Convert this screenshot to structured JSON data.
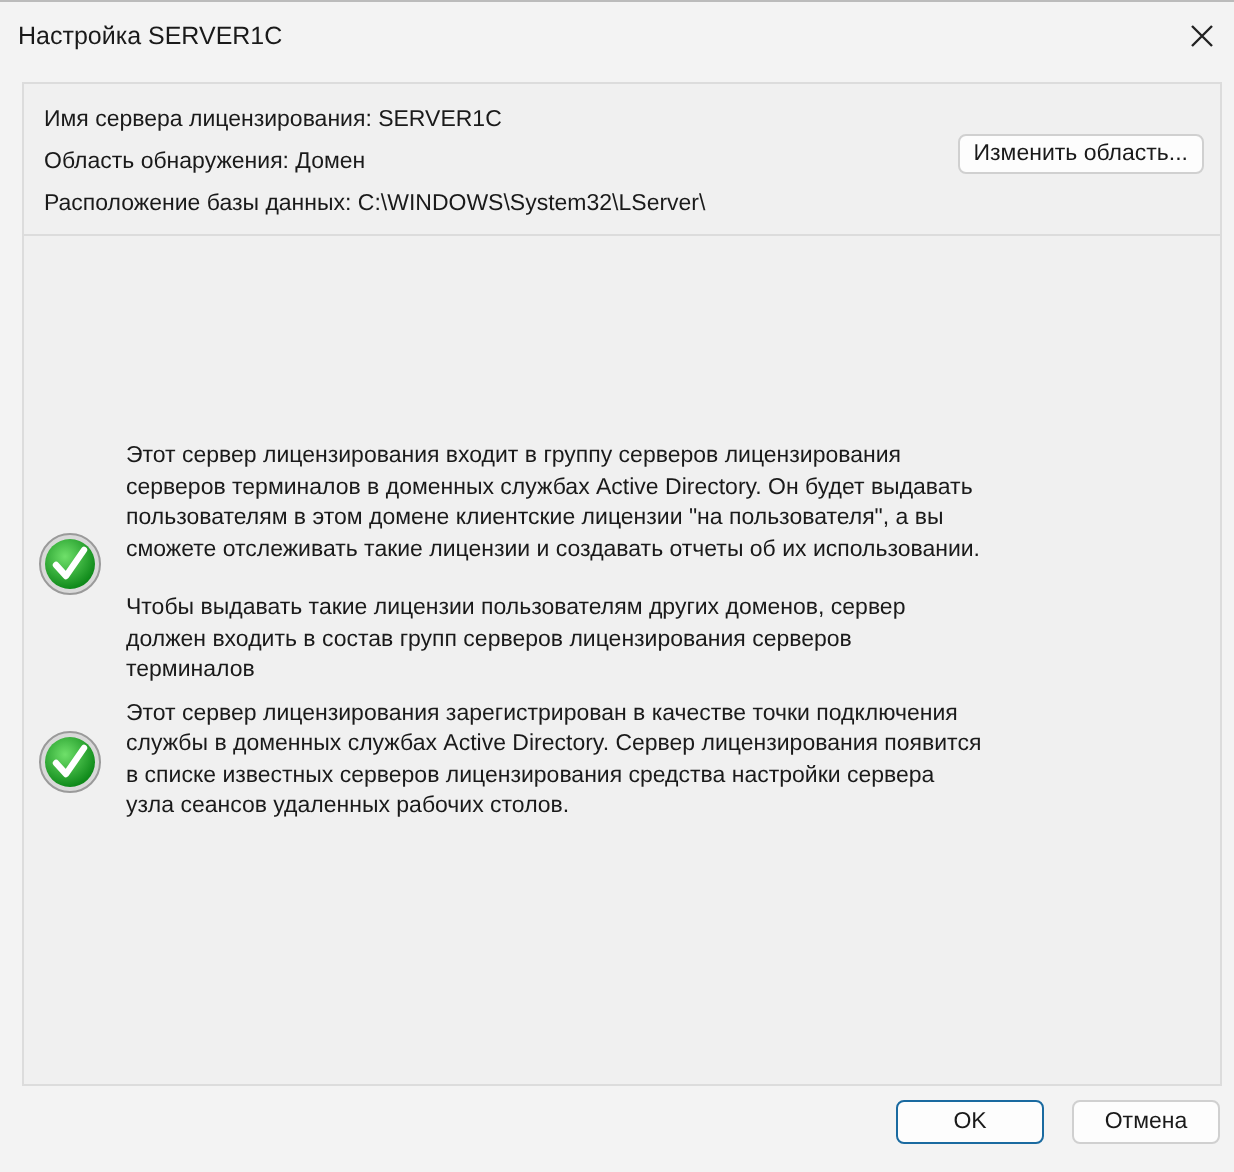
{
  "window": {
    "title": "Настройка SERVER1C"
  },
  "info": [
    {
      "text": "Имя сервера лицензирования: SERVER1C"
    },
    {
      "text": "Область обнаружения: Домен"
    },
    {
      "text": "Расположение базы данных: C:\\WINDOWS\\System32\\LServer\\"
    }
  ],
  "change_button": {
    "label": "Изменить область..."
  },
  "messages": [
    {
      "kind": "success",
      "paragraphs": [
        "Этот сервер лицензирования входит в группу серверов лицензирования серверов терминалов в доменных службах Active Directory. Он будет выдавать пользователям в этом домене клиентские лицензии \"на пользователя\", а вы сможете отслеживать такие лицензии и создавать отчеты об их использовании.",
        "Чтобы выдавать такие лицензии пользователям других доменов, сервер должен входить в состав групп серверов лицензирования серверов терминалов"
      ]
    },
    {
      "kind": "success",
      "paragraphs": [
        "Этот сервер лицензирования зарегистрирован в качестве точки подключения службы в доменных службах Active Directory. Сервер лицензирования появится в списке известных серверов лицензирования средства настройки сервера узла сеансов удаленных рабочих столов."
      ]
    }
  ],
  "buttons": [
    {
      "label": "OK",
      "kind": "primary"
    },
    {
      "label": "Отмена",
      "kind": "default"
    }
  ]
}
